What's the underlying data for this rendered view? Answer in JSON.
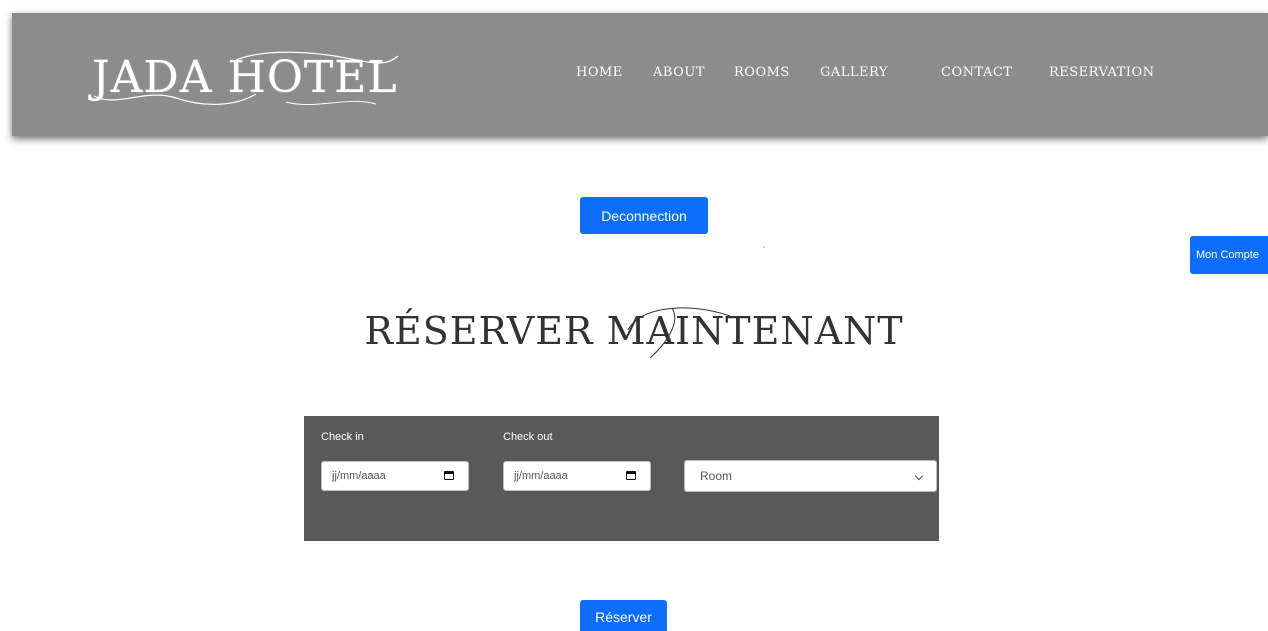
{
  "header": {
    "logo": "JADA HOTEL",
    "nav": [
      {
        "label": "HOME"
      },
      {
        "label": "ABOUT"
      },
      {
        "label": "ROOMS"
      },
      {
        "label": "GALLERY"
      },
      {
        "label": "CONTACT"
      },
      {
        "label": "RESERVATION"
      }
    ]
  },
  "actions": {
    "deconnection_label": "Deconnection",
    "compte_label": "Mon Compte"
  },
  "title": "RÉSERVER MAINTENANT",
  "booking": {
    "checkin_label": "Check in",
    "checkin_value": "jj/mm/aaaa",
    "checkout_label": "Check out",
    "checkout_value": "jj/mm/aaaa",
    "room_selected": "Room",
    "submit_label": "Réserver"
  },
  "colors": {
    "header_bg": "#8c8c8c",
    "form_bg": "#595959",
    "accent": "#0d6efd"
  },
  "icons": [
    "calendar-icon",
    "chevron-down-icon"
  ]
}
